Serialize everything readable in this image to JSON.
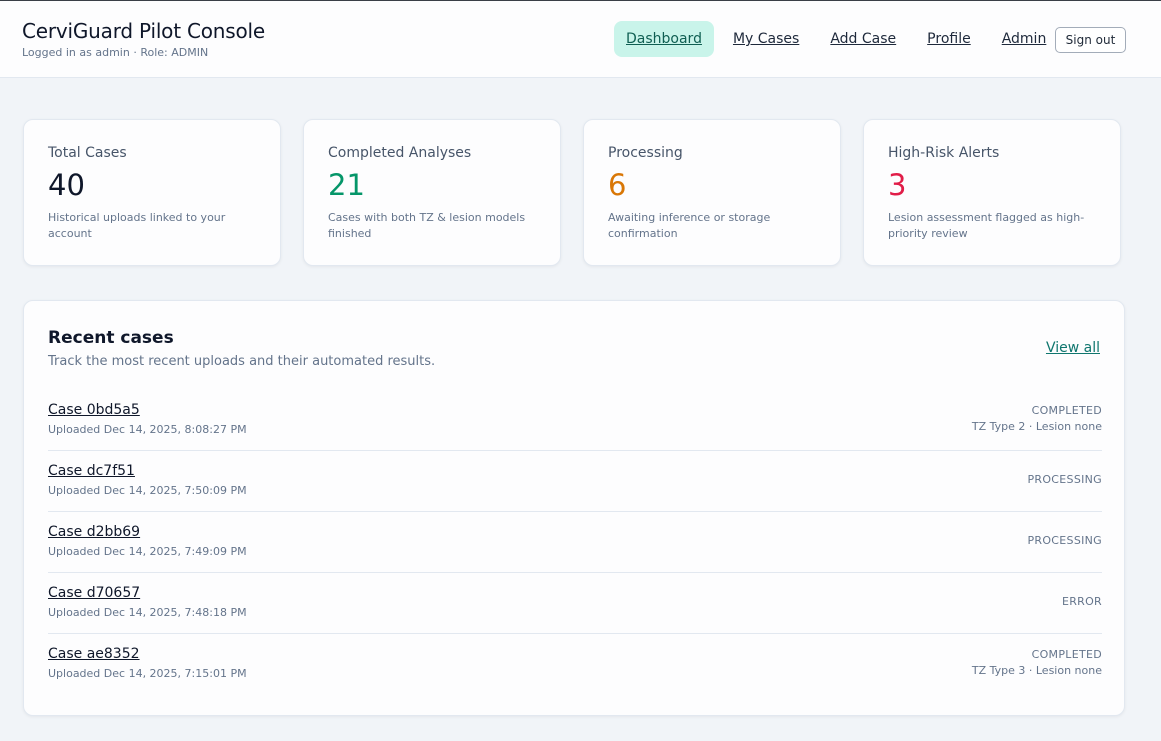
{
  "header": {
    "title": "CerviGuard Pilot Console",
    "subtitle": "Logged in as admin · Role: ADMIN",
    "nav": [
      {
        "label": "Dashboard",
        "active": true
      },
      {
        "label": "My Cases",
        "active": false
      },
      {
        "label": "Add Case",
        "active": false
      },
      {
        "label": "Profile",
        "active": false
      },
      {
        "label": "Admin",
        "active": false
      }
    ],
    "signout_label": "Sign out"
  },
  "stats": [
    {
      "label": "Total Cases",
      "value": "40",
      "description": "Historical uploads linked to your account",
      "color": "#0f172a"
    },
    {
      "label": "Completed Analyses",
      "value": "21",
      "description": "Cases with both TZ & lesion models finished",
      "color": "#059669"
    },
    {
      "label": "Processing",
      "value": "6",
      "description": "Awaiting inference or storage confirmation",
      "color": "#d97706"
    },
    {
      "label": "High-Risk Alerts",
      "value": "3",
      "description": "Lesion assessment flagged as high-priority review",
      "color": "#e11d48"
    }
  ],
  "recent": {
    "title": "Recent cases",
    "subtitle": "Track the most recent uploads and their automated results.",
    "view_all_label": "View all",
    "cases": [
      {
        "name": "Case 0bd5a5",
        "uploaded": "Uploaded Dec 14, 2025, 8:08:27 PM",
        "status": "COMPLETED",
        "detail": "TZ Type 2 · Lesion none"
      },
      {
        "name": "Case dc7f51",
        "uploaded": "Uploaded Dec 14, 2025, 7:50:09 PM",
        "status": "PROCESSING",
        "detail": ""
      },
      {
        "name": "Case d2bb69",
        "uploaded": "Uploaded Dec 14, 2025, 7:49:09 PM",
        "status": "PROCESSING",
        "detail": ""
      },
      {
        "name": "Case d70657",
        "uploaded": "Uploaded Dec 14, 2025, 7:48:18 PM",
        "status": "ERROR",
        "detail": ""
      },
      {
        "name": "Case ae8352",
        "uploaded": "Uploaded Dec 14, 2025, 7:15:01 PM",
        "status": "COMPLETED",
        "detail": "TZ Type 3 · Lesion none"
      }
    ]
  }
}
